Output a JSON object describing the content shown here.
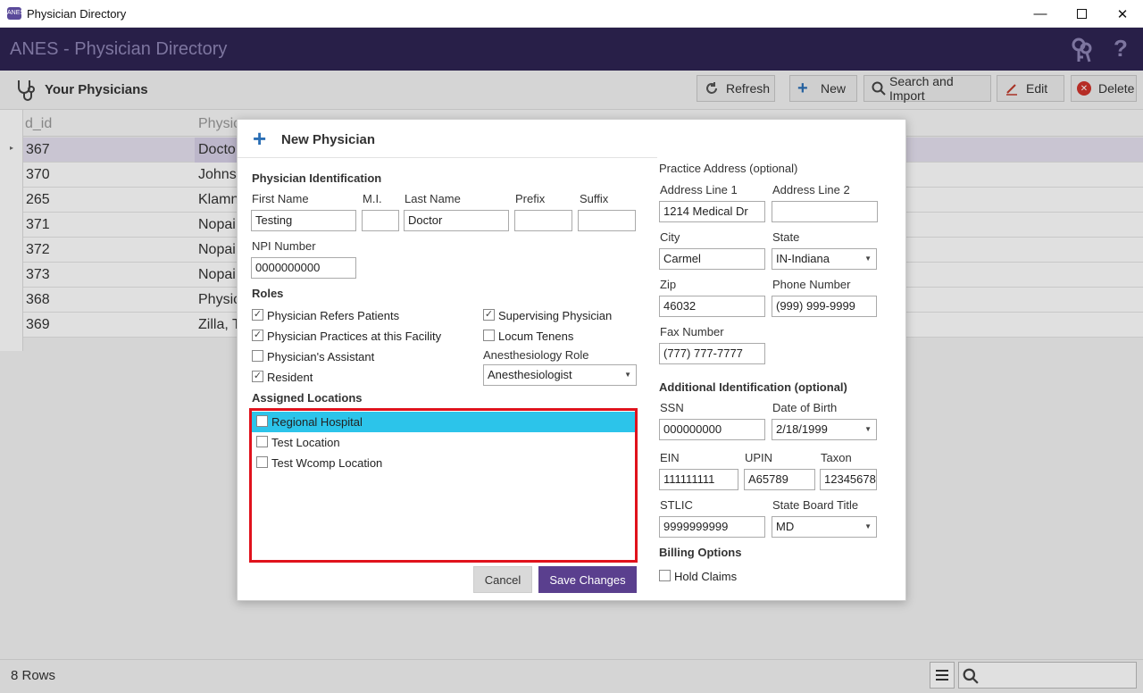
{
  "window": {
    "title": "Physician Directory",
    "icon": "app-icon",
    "icon_text": "ANES"
  },
  "appbar": {
    "title": "ANES - Physician Directory",
    "icons": [
      "keys-icon",
      "help-icon"
    ],
    "accent": "#2e2452"
  },
  "toolbar": {
    "section_title": "Your Physicians",
    "refresh": "Refresh",
    "new": "New",
    "search_import": "Search and Import",
    "edit": "Edit",
    "delete": "Delete"
  },
  "grid": {
    "columns": [
      "d_id",
      "Physic"
    ],
    "rows": [
      {
        "id": "367",
        "name": "Docto"
      },
      {
        "id": "370",
        "name": "Johns"
      },
      {
        "id": "265",
        "name": "Klamn"
      },
      {
        "id": "371",
        "name": "Nopai"
      },
      {
        "id": "372",
        "name": "Nopai"
      },
      {
        "id": "373",
        "name": "Nopai"
      },
      {
        "id": "368",
        "name": "Physic"
      },
      {
        "id": "369",
        "name": "Zilla, T"
      }
    ]
  },
  "status": {
    "rows": "8 Rows"
  },
  "dialog": {
    "title": "New Physician",
    "identification": {
      "heading": "Physician Identification",
      "first_name_label": "First Name",
      "first_name": "Testing",
      "mi_label": "M.I.",
      "mi": "",
      "last_name_label": "Last Name",
      "last_name": "Doctor",
      "prefix_label": "Prefix",
      "prefix": "",
      "suffix_label": "Suffix",
      "suffix": "",
      "npi_label": "NPI Number",
      "npi": "0000000000"
    },
    "roles": {
      "heading": "Roles",
      "refers": {
        "label": "Physician Refers Patients",
        "checked": true
      },
      "practices": {
        "label": "Physician Practices at this Facility",
        "checked": true
      },
      "assistant": {
        "label": "Physician's Assistant",
        "checked": false
      },
      "resident": {
        "label": "Resident",
        "checked": true
      },
      "supervising": {
        "label": "Supervising Physician",
        "checked": true
      },
      "locum": {
        "label": "Locum Tenens",
        "checked": false
      },
      "anes_role_label": "Anesthesiology Role",
      "anes_role": "Anesthesiologist"
    },
    "locations": {
      "heading": "Assigned Locations",
      "items": [
        {
          "label": "Regional Hospital",
          "checked": false
        },
        {
          "label": "Test Location",
          "checked": false
        },
        {
          "label": "Test Wcomp Location",
          "checked": false
        }
      ],
      "highlight_color": "#2cc4ea",
      "outline_color": "#e0121c"
    },
    "address": {
      "heading": "Practice Address (optional)",
      "line1_label": "Address Line 1",
      "line1": "1214 Medical Dr",
      "line2_label": "Address Line 2",
      "line2": "",
      "city_label": "City",
      "city": "Carmel",
      "state_label": "State",
      "state": "IN-Indiana",
      "zip_label": "Zip",
      "zip": "46032",
      "phone_label": "Phone Number",
      "phone": "(999) 999-9999",
      "fax_label": "Fax Number",
      "fax": "(777) 777-7777"
    },
    "additional": {
      "heading": "Additional Identification (optional)",
      "ssn_label": "SSN",
      "ssn": "000000000",
      "dob_label": "Date of Birth",
      "dob": "2/18/1999",
      "ein_label": "EIN",
      "ein": "111111111",
      "upin_label": "UPIN",
      "upin": "A65789",
      "taxon_label": "Taxon",
      "taxon": "12345678",
      "stlic_label": "STLIC",
      "stlic": "9999999999",
      "board_label": "State Board Title",
      "board": "MD"
    },
    "billing": {
      "heading": "Billing Options",
      "hold_claims": {
        "label": "Hold Claims",
        "checked": false
      }
    },
    "cancel": "Cancel",
    "save": "Save Changes",
    "save_color": "#5a3f8e"
  }
}
